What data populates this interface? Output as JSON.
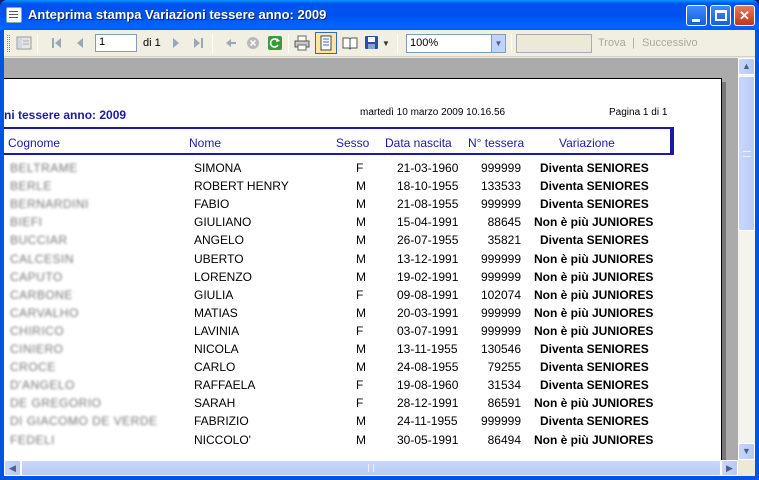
{
  "window": {
    "title": "Anteprima stampa Variazioni tessere anno:  2009"
  },
  "toolbar": {
    "page_value": "1",
    "of_label": "di 1",
    "zoom_value": "100%",
    "find_value": "",
    "find_label": "Trova",
    "find_separator": "|",
    "next_label": "Successivo"
  },
  "report": {
    "title": "ni tessere anno:  2009",
    "date": "martedì 10 marzo 2009 10.16.56",
    "page": "Pagina 1 di 1",
    "headers": {
      "cognome": "Cognome",
      "nome": "Nome",
      "sesso": "Sesso",
      "data": "Data nascita",
      "tessera": "N° tessera",
      "variazione": "Variazione"
    },
    "rows": [
      {
        "cognome": "BELTRAME",
        "nome": "SIMONA",
        "sesso": "F",
        "data": "21-03-1960",
        "tessera": "999999",
        "variazione": "Diventa SENIORES"
      },
      {
        "cognome": "BERLE",
        "nome": "ROBERT HENRY",
        "sesso": "M",
        "data": "18-10-1955",
        "tessera": "133533",
        "variazione": "Diventa SENIORES"
      },
      {
        "cognome": "BERNARDINI",
        "nome": "FABIO",
        "sesso": "M",
        "data": "21-08-1955",
        "tessera": "999999",
        "variazione": "Diventa SENIORES"
      },
      {
        "cognome": "BIEFI",
        "nome": "GIULIANO",
        "sesso": "M",
        "data": "15-04-1991",
        "tessera": "88645",
        "variazione": "Non è più JUNIORES"
      },
      {
        "cognome": "BUCCIAR",
        "nome": "ANGELO",
        "sesso": "M",
        "data": "26-07-1955",
        "tessera": "35821",
        "variazione": "Diventa SENIORES"
      },
      {
        "cognome": "CALCESIN",
        "nome": "UBERTO",
        "sesso": "M",
        "data": "13-12-1991",
        "tessera": "999999",
        "variazione": "Non è più JUNIORES"
      },
      {
        "cognome": "CAPUTO",
        "nome": "LORENZO",
        "sesso": "M",
        "data": "19-02-1991",
        "tessera": "999999",
        "variazione": "Non è più JUNIORES"
      },
      {
        "cognome": "CARBONE",
        "nome": "GIULIA",
        "sesso": "F",
        "data": "09-08-1991",
        "tessera": "102074",
        "variazione": "Non è più JUNIORES"
      },
      {
        "cognome": "CARVALHO",
        "nome": "MATIAS",
        "sesso": "M",
        "data": "20-03-1991",
        "tessera": "999999",
        "variazione": "Non è più JUNIORES"
      },
      {
        "cognome": "CHIRICO",
        "nome": "LAVINIA",
        "sesso": "F",
        "data": "03-07-1991",
        "tessera": "999999",
        "variazione": "Non è più JUNIORES"
      },
      {
        "cognome": "CINIERO",
        "nome": "NICOLA",
        "sesso": "M",
        "data": "13-11-1955",
        "tessera": "130546",
        "variazione": "Diventa SENIORES"
      },
      {
        "cognome": "CROCE",
        "nome": "CARLO",
        "sesso": "M",
        "data": "24-08-1955",
        "tessera": "79255",
        "variazione": "Diventa SENIORES"
      },
      {
        "cognome": "D'ANGELO",
        "nome": "RAFFAELA",
        "sesso": "F",
        "data": "19-08-1960",
        "tessera": "31534",
        "variazione": "Diventa SENIORES"
      },
      {
        "cognome": "DE GREGORIO",
        "nome": "SARAH",
        "sesso": "F",
        "data": "28-12-1991",
        "tessera": "86591",
        "variazione": "Non è più JUNIORES"
      },
      {
        "cognome": "DI GIACOMO DE VERDE",
        "nome": "FABRIZIO",
        "sesso": "M",
        "data": "24-11-1955",
        "tessera": "999999",
        "variazione": "Diventa SENIORES"
      },
      {
        "cognome": "FEDELI",
        "nome": "NICCOLO'",
        "sesso": "M",
        "data": "30-05-1991",
        "tessera": "86494",
        "variazione": "Non è più JUNIORES"
      }
    ]
  }
}
